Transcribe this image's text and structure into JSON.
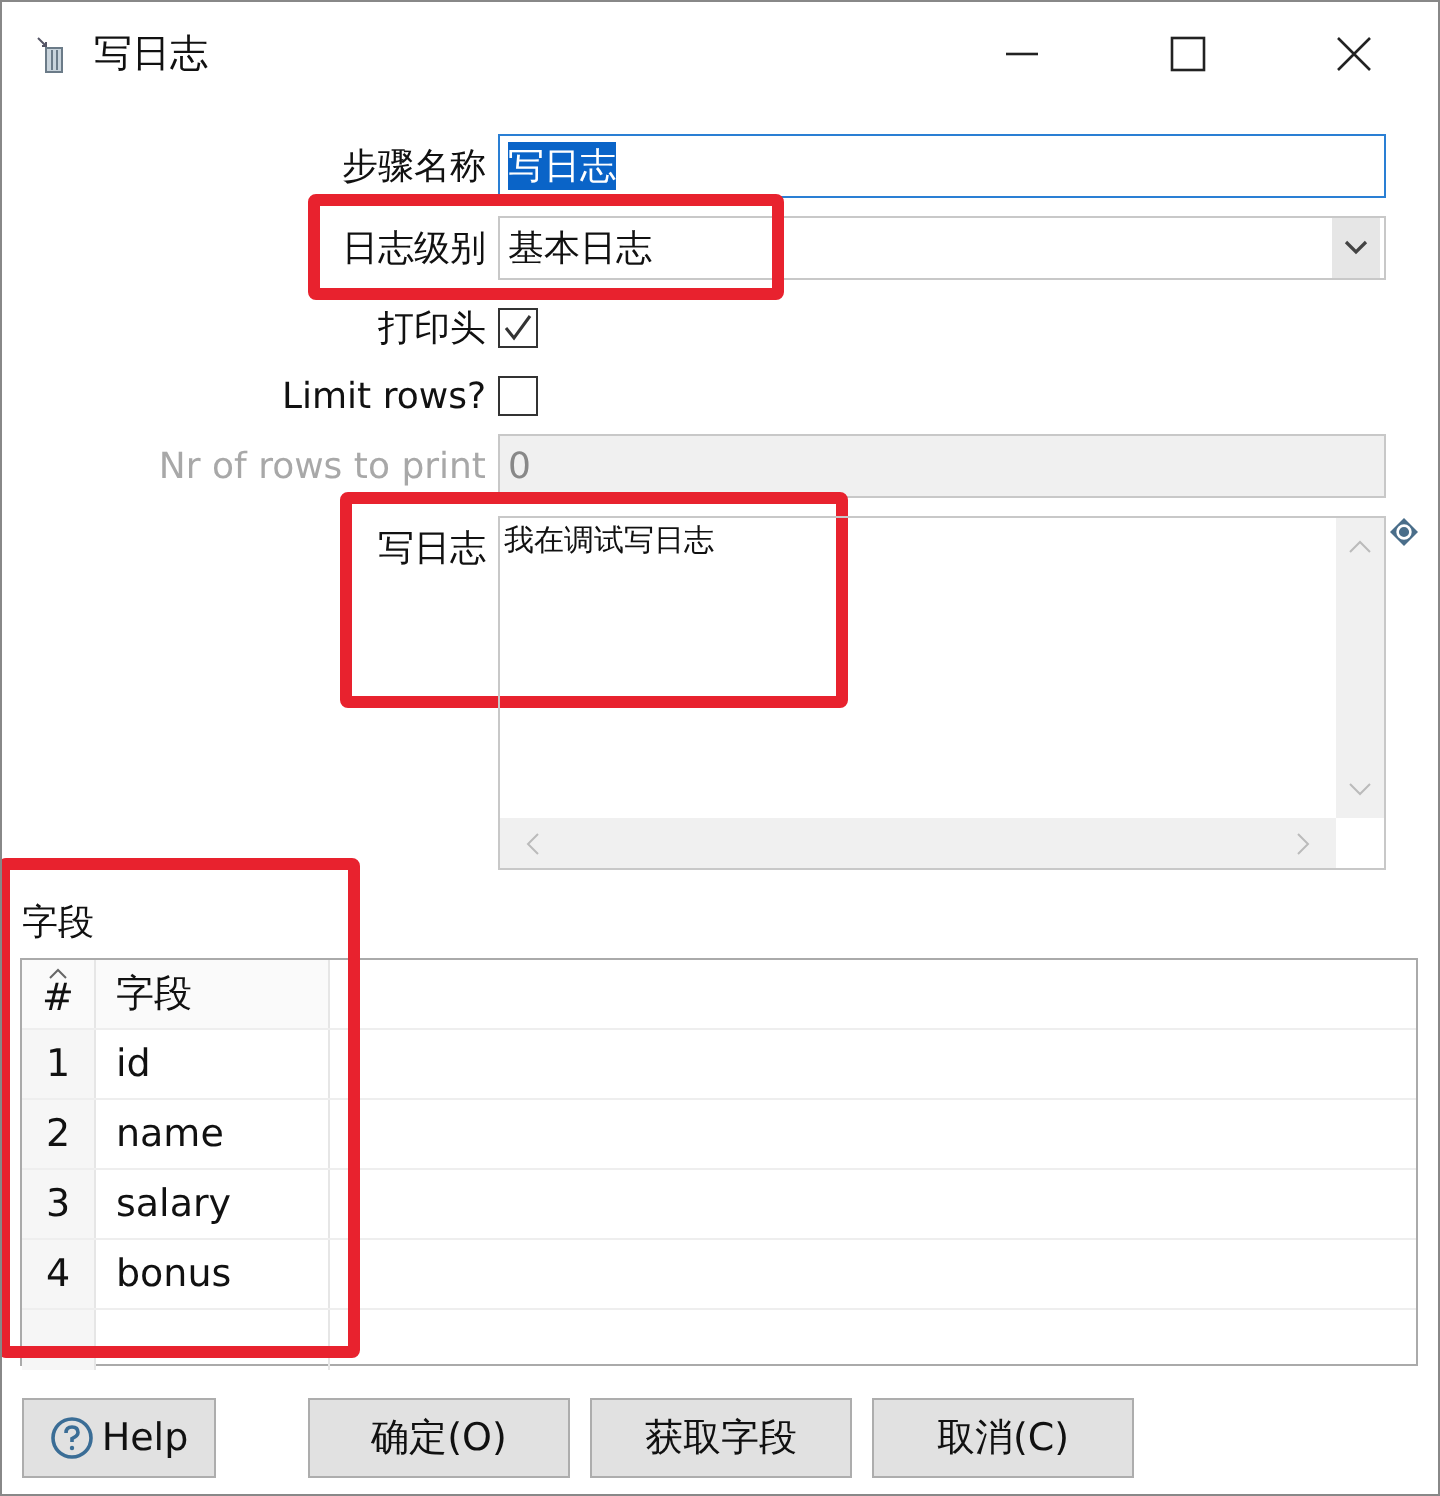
{
  "window": {
    "title": "写日志"
  },
  "step_name": {
    "label": "步骤名称",
    "value": "写日志",
    "text_selected": true
  },
  "log_level": {
    "label": "日志级别",
    "value": "基本日志",
    "highlighted": true
  },
  "print_header": {
    "label": "打印头",
    "checked": true
  },
  "limit_rows": {
    "label": "Limit rows?",
    "checked": false
  },
  "rows_to_print": {
    "label": "Nr of rows to print",
    "value": "0",
    "disabled": true
  },
  "log_text": {
    "label": "写日志",
    "value": "我在调试写日志",
    "highlighted": true
  },
  "fields": {
    "label": "字段",
    "highlighted": true,
    "columns": [
      "#",
      "字段"
    ],
    "rows": [
      {
        "index": "1",
        "field": "id"
      },
      {
        "index": "2",
        "field": "name"
      },
      {
        "index": "3",
        "field": "salary"
      },
      {
        "index": "4",
        "field": "bonus"
      }
    ]
  },
  "buttons": [
    {
      "kind": "help",
      "label": "Help"
    },
    {
      "kind": "plain",
      "label": "确定(O)"
    },
    {
      "kind": "plain",
      "label": "获取字段"
    },
    {
      "kind": "plain",
      "label": "取消(C)"
    }
  ]
}
